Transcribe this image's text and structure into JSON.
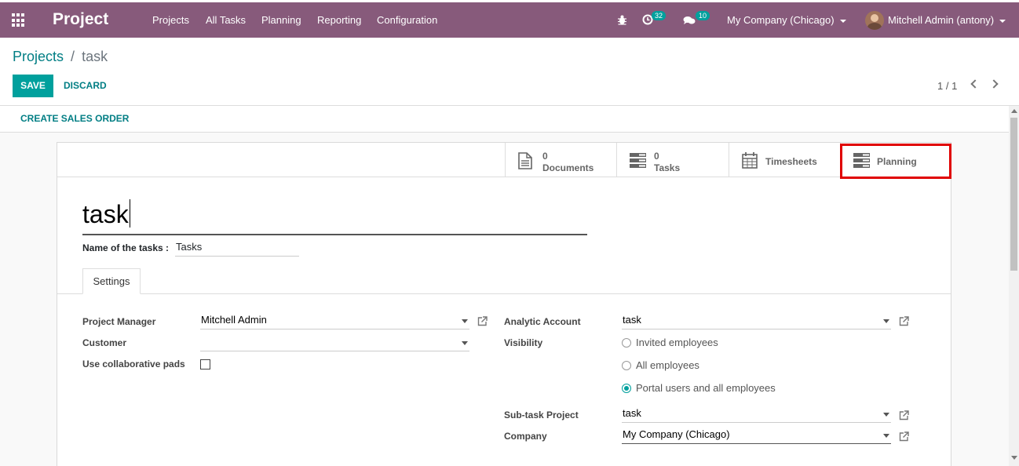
{
  "navbar": {
    "app_title": "Project",
    "menu": [
      "Projects",
      "All Tasks",
      "Planning",
      "Reporting",
      "Configuration"
    ],
    "activity_count": "32",
    "messages_count": "10",
    "company_switcher": "My Company (Chicago)",
    "user": "Mitchell Admin (antony)"
  },
  "breadcrumb": {
    "parent": "Projects",
    "separator": "/",
    "current": "task"
  },
  "buttons": {
    "save": "SAVE",
    "discard": "DISCARD",
    "create_sales_order": "CREATE SALES ORDER"
  },
  "pager": {
    "value": "1 / 1"
  },
  "stat_buttons": [
    {
      "count": "0",
      "label": "Documents",
      "icon": "document-icon"
    },
    {
      "count": "0",
      "label": "Tasks",
      "icon": "tasks-icon"
    },
    {
      "label": "Timesheets",
      "icon": "calendar-icon"
    },
    {
      "label": "Planning",
      "icon": "planning-icon"
    }
  ],
  "form": {
    "title": "task",
    "tasks_name_label": "Name of the tasks :",
    "tasks_name_value": "Tasks",
    "tab": "Settings",
    "left": {
      "project_manager_label": "Project Manager",
      "project_manager_value": "Mitchell Admin",
      "customer_label": "Customer",
      "customer_value": "",
      "collab_pads_label": "Use collaborative pads",
      "collab_pads_checked": false
    },
    "right": {
      "analytic_account_label": "Analytic Account",
      "analytic_account_value": "task",
      "visibility_label": "Visibility",
      "visibility_options": [
        "Invited employees",
        "All employees",
        "Portal users and all employees"
      ],
      "visibility_selected": "Portal users and all employees",
      "subtask_project_label": "Sub-task Project",
      "subtask_project_value": "task",
      "company_label": "Company",
      "company_value": "My Company (Chicago)"
    }
  },
  "colors": {
    "navbar": "#875a7b",
    "primary": "#00a09d",
    "link": "#017e84",
    "highlight": "#e00000"
  }
}
